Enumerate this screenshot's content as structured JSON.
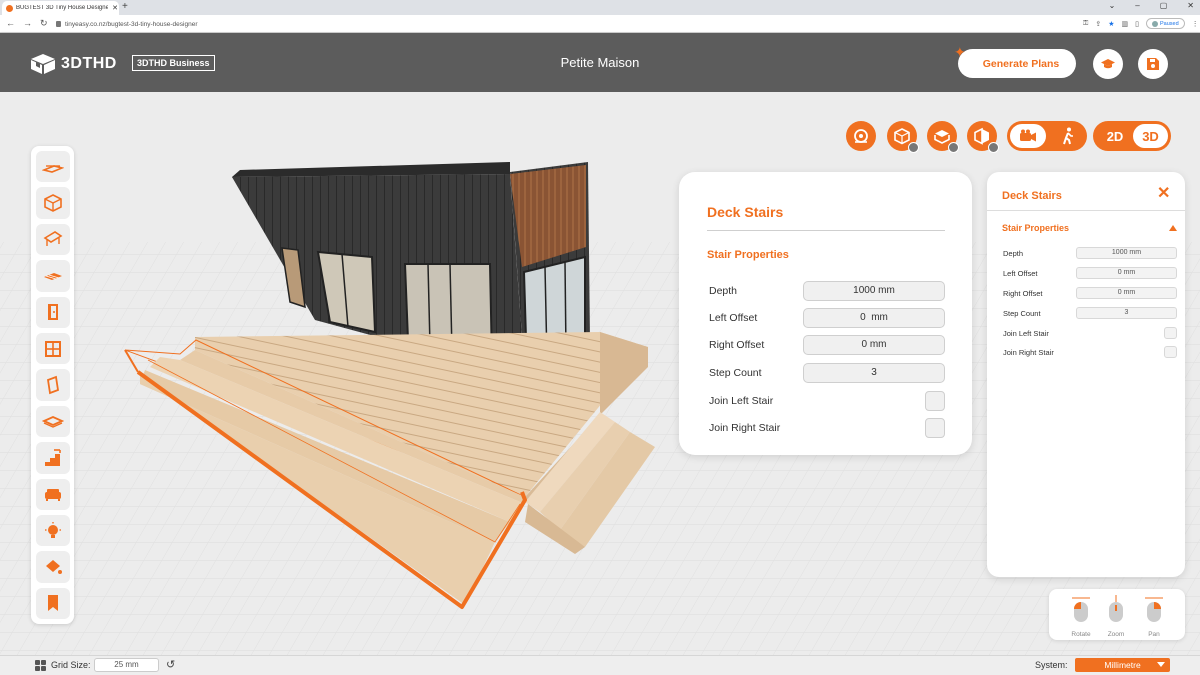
{
  "browser": {
    "tab_title": "BUGTEST 3D Tiny House Designer",
    "url": "tinyeasy.co.nz/bugtest-3d-tiny-house-designer",
    "profile_status": "Paused"
  },
  "header": {
    "logo_text": "3DTHD",
    "business_badge": "3DTHD Business",
    "project_title": "Petite Maison",
    "generate_plans_label": "Generate Plans"
  },
  "view_toggle": {
    "label_2d": "2D",
    "label_3d": "3D",
    "selected": "3D"
  },
  "stairs_panel": {
    "title": "Deck Stairs",
    "section": "Stair Properties",
    "fields": [
      {
        "label": "Depth",
        "value": "1000 mm"
      },
      {
        "label": "Left Offset",
        "value": "0  mm"
      },
      {
        "label": "Right Offset",
        "value": "0 mm"
      },
      {
        "label": "Step Count",
        "value": "3"
      }
    ],
    "checks": [
      {
        "label": "Join Left Stair"
      },
      {
        "label": "Join Right Stair"
      }
    ]
  },
  "side_panel": {
    "title": "Deck Stairs",
    "section": "Stair Properties",
    "fields": [
      {
        "label": "Depth",
        "value": "1000 mm"
      },
      {
        "label": "Left Offset",
        "value": "0 mm"
      },
      {
        "label": "Right Offset",
        "value": "0 mm"
      },
      {
        "label": "Step Count",
        "value": "3"
      }
    ],
    "checks": [
      {
        "label": "Join Left Stair"
      },
      {
        "label": "Join Right Stair"
      }
    ]
  },
  "mouse_hints": {
    "rotate": "Rotate",
    "zoom": "Zoom",
    "pan": "Pan"
  },
  "statusbar": {
    "grid_label": "Grid Size:",
    "grid_value": "25 mm",
    "system_label": "System:",
    "system_value": "Millimetre"
  },
  "colors": {
    "accent": "#f07020",
    "header_bg": "#5c5c5c",
    "deck_wood": "#e8cba8",
    "cladding": "#3a3a3a"
  }
}
